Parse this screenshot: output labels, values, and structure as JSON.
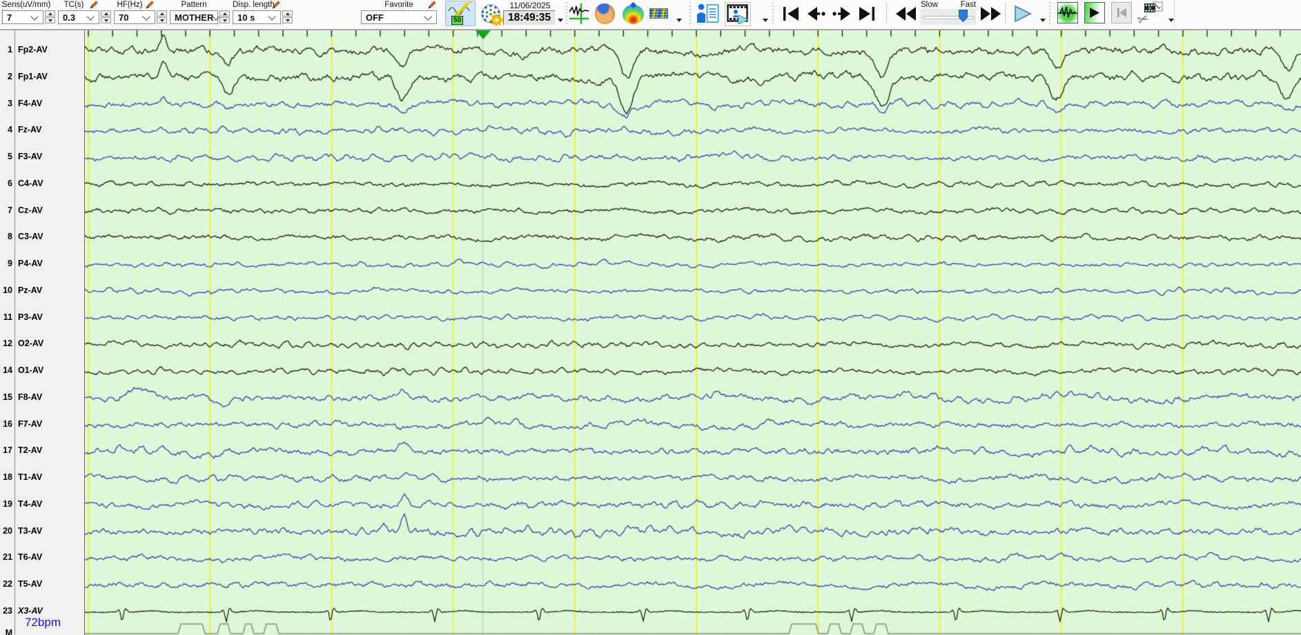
{
  "toolbar": {
    "combos": [
      {
        "label": "Sens(uV/mm)",
        "value": "7"
      },
      {
        "label": "TC(s)",
        "value": "0.3"
      },
      {
        "label": "HF(Hz)",
        "value": "70"
      },
      {
        "label": "Pattern",
        "value": "MOTHER"
      },
      {
        "label": "Disp. length",
        "value": "10 s"
      },
      {
        "label": "Favorite",
        "value": "OFF"
      }
    ],
    "filter_badge": "50",
    "date": "11/06/2025",
    "time": "18:49:35",
    "speed": {
      "slow_label": "Slow",
      "fast_label": "Fast"
    }
  },
  "channels": [
    {
      "num": "1",
      "label": "Fp2-AV",
      "color": "black"
    },
    {
      "num": "2",
      "label": "Fp1-AV",
      "color": "black"
    },
    {
      "num": "3",
      "label": "F4-AV",
      "color": "blue"
    },
    {
      "num": "4",
      "label": "Fz-AV",
      "color": "blue"
    },
    {
      "num": "5",
      "label": "F3-AV",
      "color": "blue"
    },
    {
      "num": "6",
      "label": "C4-AV",
      "color": "black"
    },
    {
      "num": "7",
      "label": "Cz-AV",
      "color": "black"
    },
    {
      "num": "8",
      "label": "C3-AV",
      "color": "black"
    },
    {
      "num": "9",
      "label": "P4-AV",
      "color": "blue"
    },
    {
      "num": "10",
      "label": "Pz-AV",
      "color": "blue"
    },
    {
      "num": "11",
      "label": "P3-AV",
      "color": "blue"
    },
    {
      "num": "12",
      "label": "O2-AV",
      "color": "black"
    },
    {
      "num": "14",
      "label": "O1-AV",
      "color": "black"
    },
    {
      "num": "15",
      "label": "F8-AV",
      "color": "blue"
    },
    {
      "num": "16",
      "label": "F7-AV",
      "color": "blue"
    },
    {
      "num": "17",
      "label": "T2-AV",
      "color": "blue"
    },
    {
      "num": "18",
      "label": "T1-AV",
      "color": "blue"
    },
    {
      "num": "19",
      "label": "T4-AV",
      "color": "blue"
    },
    {
      "num": "20",
      "label": "T3-AV",
      "color": "blue"
    },
    {
      "num": "21",
      "label": "T6-AV",
      "color": "blue"
    },
    {
      "num": "22",
      "label": "T5-AV",
      "color": "blue"
    },
    {
      "num": "23",
      "label": "X3-AV",
      "color": "black",
      "italic": true,
      "ekg": true
    }
  ],
  "heart_rate": "72bpm",
  "marker_label": "M",
  "colors": {
    "trace_black": "#000000",
    "trace_blue": "#1c2fa6",
    "bg_green": "#def7d8",
    "grid_major": "#eef23c",
    "grid_minor": "#f0ef8e",
    "event_gray": "#8a8a8a"
  }
}
